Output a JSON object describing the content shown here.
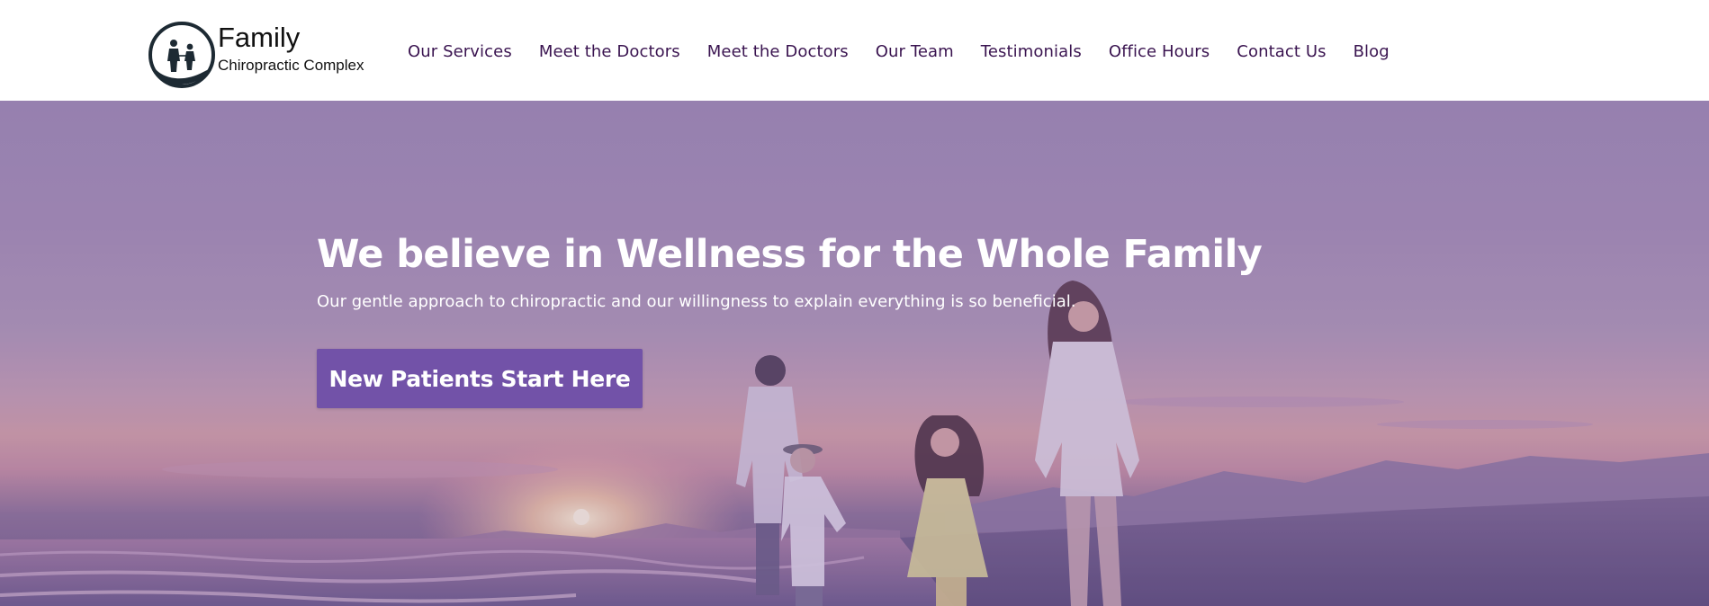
{
  "colors": {
    "nav_text": "#3a1450",
    "cta_background": "#7252a8",
    "hero_tint": "#9c86b4",
    "logo_mark": "#1d2a33",
    "header_background": "#ffffff"
  },
  "logo": {
    "title": "Family",
    "subtitle": "Chiropractic Complex",
    "icon": "family-hand-icon"
  },
  "nav": {
    "items": [
      {
        "label": "Our Services"
      },
      {
        "label": "Meet the Doctors"
      },
      {
        "label": "Meet the Doctors"
      },
      {
        "label": "Our Team"
      },
      {
        "label": "Testimonials"
      },
      {
        "label": "Office Hours"
      },
      {
        "label": "Contact Us"
      },
      {
        "label": "Blog"
      }
    ]
  },
  "hero": {
    "headline": "We believe in Wellness for the Whole Family",
    "subheadline": "Our gentle approach to chiropractic and our willingness to explain everything is so beneficial.",
    "cta_label": "New Patients Start Here",
    "background_image": "family-walking-on-beach-at-sunset"
  }
}
